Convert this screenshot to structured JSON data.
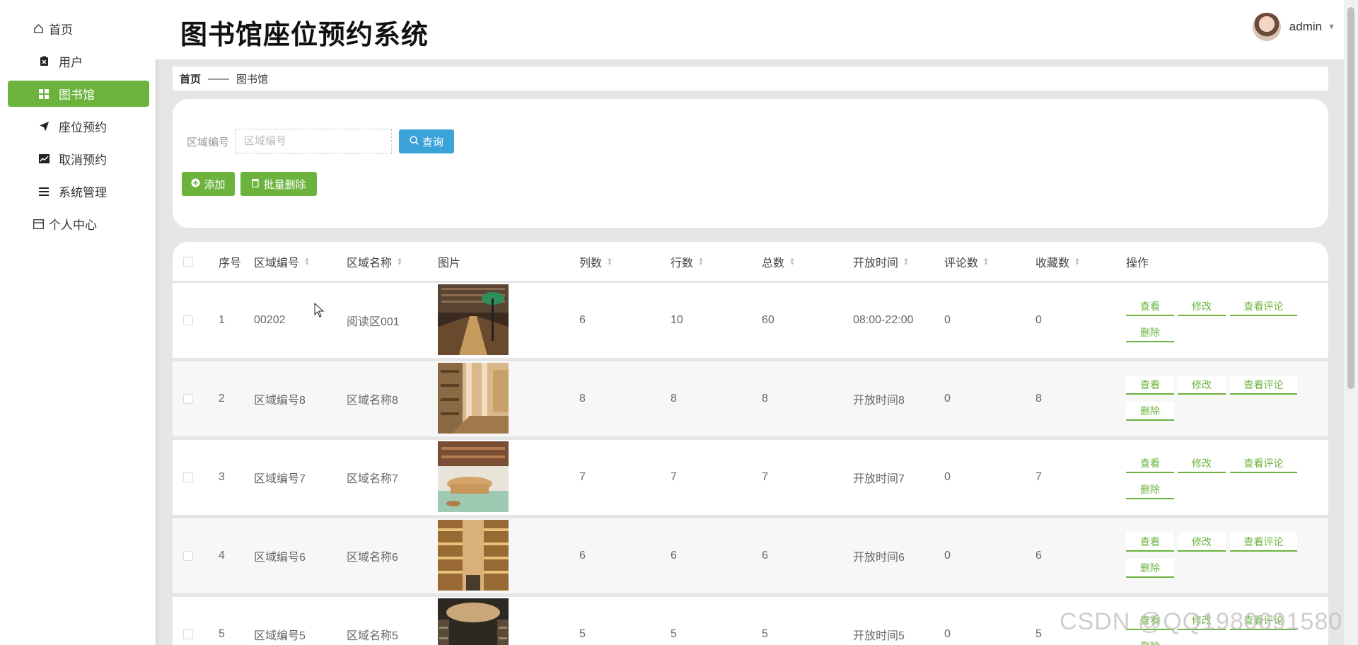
{
  "app": {
    "title": "图书馆座位预约系统"
  },
  "user": {
    "name": "admin"
  },
  "sidebar": {
    "items": [
      {
        "label": "首页",
        "icon": "home-icon"
      },
      {
        "label": "用户",
        "icon": "clipboard-icon"
      },
      {
        "label": "图书馆",
        "icon": "grid-icon",
        "active": true
      },
      {
        "label": "座位预约",
        "icon": "send-icon"
      },
      {
        "label": "取消预约",
        "icon": "chart-icon"
      },
      {
        "label": "系统管理",
        "icon": "list-icon"
      },
      {
        "label": "个人中心",
        "icon": "window-icon"
      }
    ]
  },
  "breadcrumb": {
    "home": "首页",
    "separator": "——",
    "current": "图书馆"
  },
  "search": {
    "label": "区域编号",
    "placeholder": "区域编号",
    "query_button": "查询",
    "add_button": "添加",
    "batch_delete_button": "批量删除"
  },
  "table": {
    "headers": [
      "序号",
      "区域编号",
      "区域名称",
      "图片",
      "列数",
      "行数",
      "总数",
      "开放时间",
      "评论数",
      "收藏数",
      "操作"
    ],
    "actions": {
      "view": "查看",
      "edit": "修改",
      "comments": "查看评论",
      "delete": "删除"
    },
    "rows": [
      {
        "index": "1",
        "area_code": "00202",
        "area_name": "阅读区001",
        "columns": "6",
        "rows": "10",
        "total": "60",
        "open_time": "08:00-22:00",
        "comments": "0",
        "favorites": "0"
      },
      {
        "index": "2",
        "area_code": "区域编号8",
        "area_name": "区域名称8",
        "columns": "8",
        "rows": "8",
        "total": "8",
        "open_time": "开放时间8",
        "comments": "0",
        "favorites": "8"
      },
      {
        "index": "3",
        "area_code": "区域编号7",
        "area_name": "区域名称7",
        "columns": "7",
        "rows": "7",
        "total": "7",
        "open_time": "开放时间7",
        "comments": "0",
        "favorites": "7"
      },
      {
        "index": "4",
        "area_code": "区域编号6",
        "area_name": "区域名称6",
        "columns": "6",
        "rows": "6",
        "total": "6",
        "open_time": "开放时间6",
        "comments": "0",
        "favorites": "6"
      },
      {
        "index": "5",
        "area_code": "区域编号5",
        "area_name": "区域名称5",
        "columns": "5",
        "rows": "5",
        "total": "5",
        "open_time": "开放时间5",
        "comments": "0",
        "favorites": "5"
      }
    ]
  },
  "watermark": "CSDN @QQ1980691580",
  "colors": {
    "accent": "#6cb33e",
    "query": "#3ba3d8",
    "background": "#e6e6e6"
  }
}
